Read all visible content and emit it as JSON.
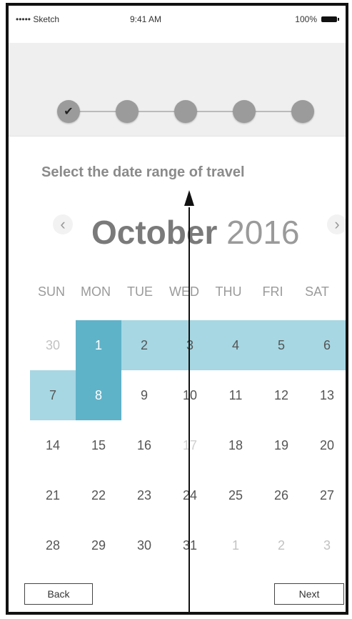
{
  "status_bar": {
    "carrier": "••••• Sketch",
    "time": "9:41 AM",
    "battery": "100%"
  },
  "progress": {
    "steps": 5,
    "current_step": 1
  },
  "prompt": "Select the date range of travel",
  "calendar": {
    "month": "October",
    "year": "2016",
    "weekdays": [
      "SUN",
      "MON",
      "TUE",
      "WED",
      "THU",
      "FRI",
      "SAT"
    ],
    "weeks": [
      [
        "30",
        "1",
        "2",
        "3",
        "4",
        "5",
        "6"
      ],
      [
        "7",
        "8",
        "9",
        "10",
        "11",
        "12",
        "13"
      ],
      [
        "14",
        "15",
        "16",
        "17",
        "18",
        "19",
        "20"
      ],
      [
        "21",
        "22",
        "23",
        "24",
        "25",
        "26",
        "27"
      ],
      [
        "28",
        "29",
        "30",
        "31",
        "1",
        "2",
        "3"
      ]
    ],
    "selected": {
      "start": "1",
      "end": "8"
    }
  },
  "buttons": {
    "back": "Back",
    "next": "Next"
  },
  "icons": {
    "prev": "chevron-left-icon",
    "next": "chevron-right-icon",
    "step_check": "check-icon"
  },
  "colors": {
    "selection_dark": "#5fb3c9",
    "selection_light": "#a6d7e3"
  }
}
